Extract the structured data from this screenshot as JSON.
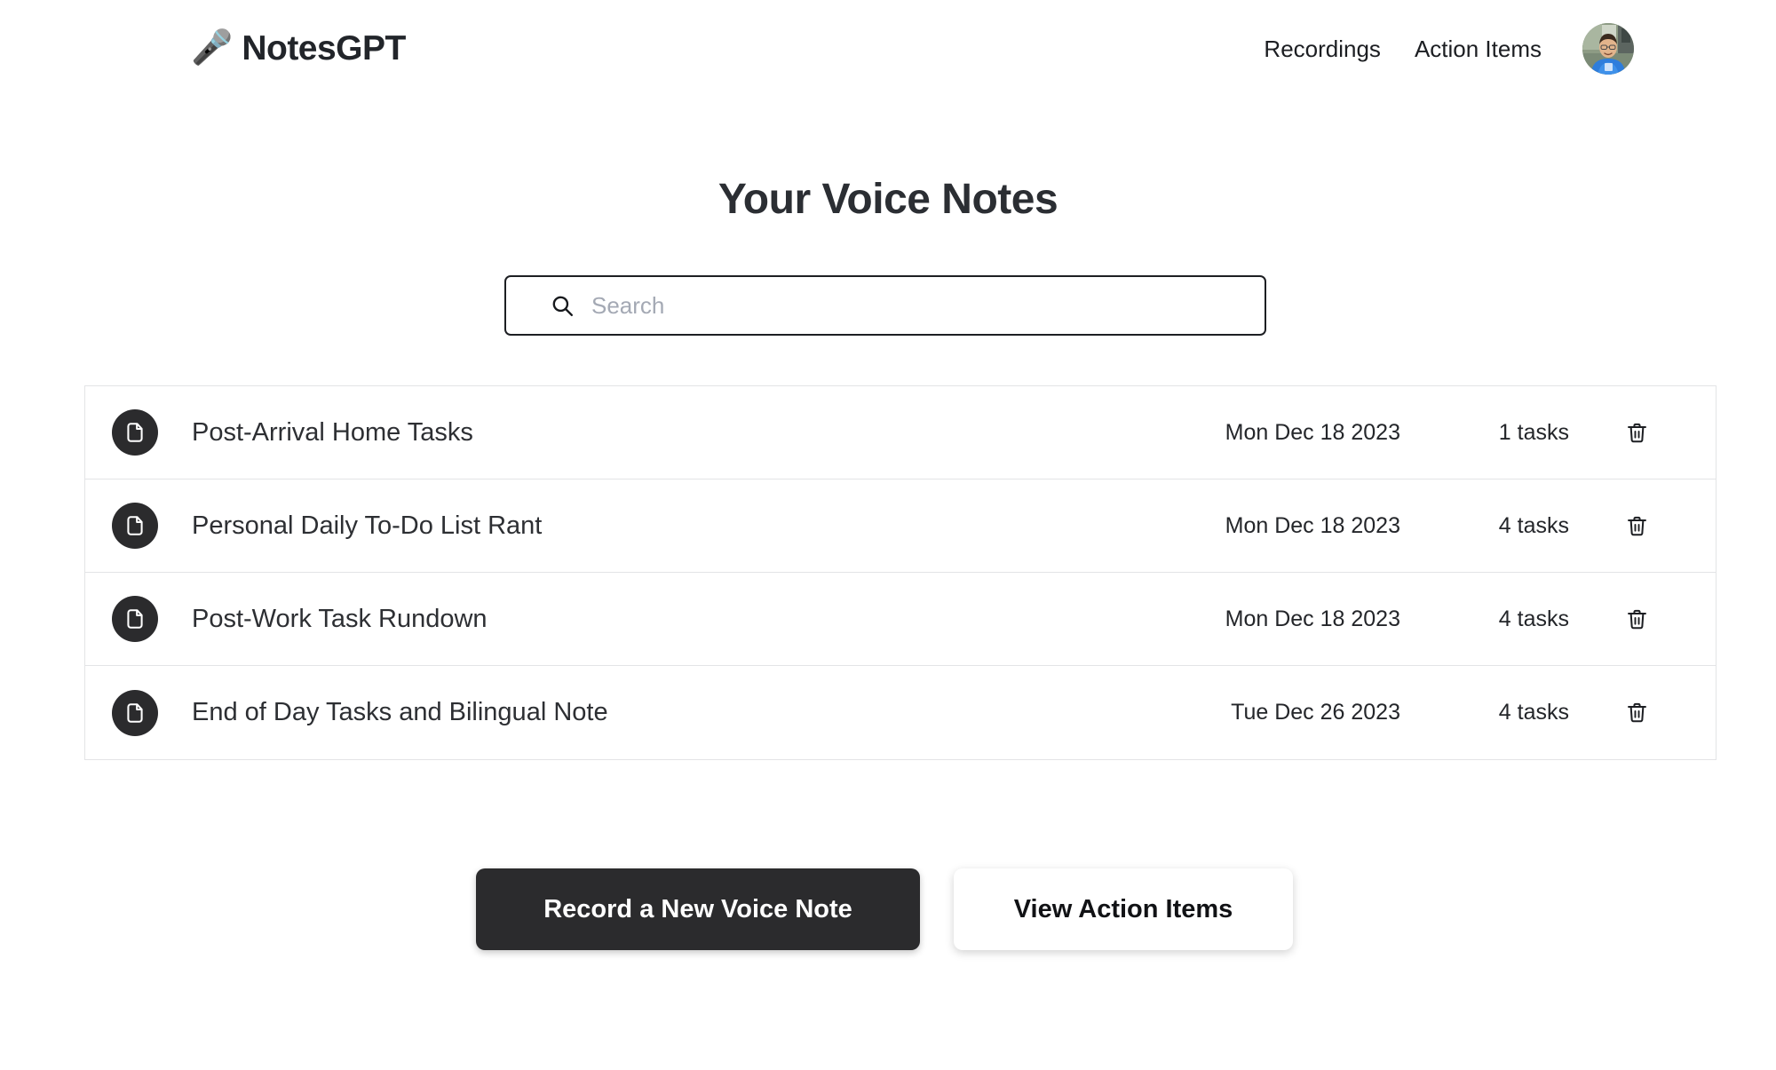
{
  "header": {
    "brand_icon": "microphone-icon",
    "brand_icon_glyph": "🎤",
    "brand_name": "NotesGPT",
    "nav": [
      {
        "label": "Recordings",
        "name": "nav-link-recordings"
      },
      {
        "label": "Action Items",
        "name": "nav-link-action-items"
      }
    ],
    "avatar_alt": "user-avatar"
  },
  "main": {
    "title": "Your Voice Notes",
    "search": {
      "placeholder": "Search",
      "value": "",
      "icon": "search-icon"
    },
    "notes": [
      {
        "icon": "document-icon",
        "title": "Post-Arrival Home Tasks",
        "date": "Mon Dec 18 2023",
        "tasks": "1 tasks",
        "delete_icon": "trash-icon"
      },
      {
        "icon": "document-icon",
        "title": "Personal Daily To-Do List Rant",
        "date": "Mon Dec 18 2023",
        "tasks": "4 tasks",
        "delete_icon": "trash-icon"
      },
      {
        "icon": "document-icon",
        "title": "Post-Work Task Rundown",
        "date": "Mon Dec 18 2023",
        "tasks": "4 tasks",
        "delete_icon": "trash-icon"
      },
      {
        "icon": "document-icon",
        "title": "End of Day Tasks and Bilingual Note",
        "date": "Tue Dec 26 2023",
        "tasks": "4 tasks",
        "delete_icon": "trash-icon"
      }
    ]
  },
  "actions": {
    "record_label": "Record a New Voice Note",
    "view_action_items_label": "View Action Items"
  },
  "colors": {
    "dark": "#2b2b2d",
    "text": "#24262a",
    "placeholder": "#a4a9b4",
    "border": "#e3e4e6",
    "accent_purple": "#6b3fa0"
  }
}
